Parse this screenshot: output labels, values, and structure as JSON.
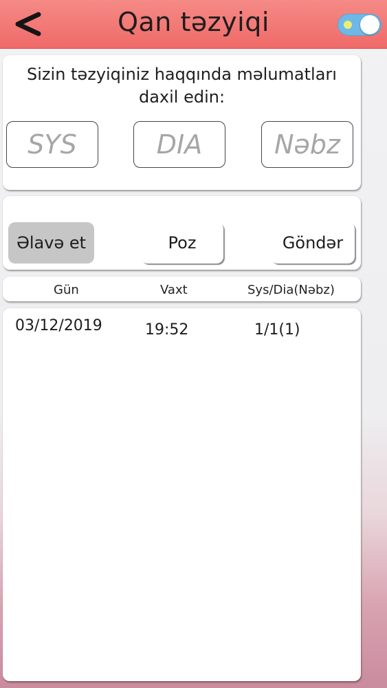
{
  "header": {
    "title": "Qan təzyiqi",
    "back_icon": "chevron-left-icon",
    "toggle_on": true
  },
  "form": {
    "intro": "Sizin təzyiqiniz haqqında məlumatları daxil edin:",
    "sys_placeholder": "SYS",
    "dia_placeholder": "DIA",
    "pulse_placeholder": "Nəbz"
  },
  "actions": {
    "add_label": "Əlavə et",
    "delete_label": "Poz",
    "send_label": "Göndər"
  },
  "table": {
    "columns": [
      "Gün",
      "Vaxt",
      "Sys/Dia(Nəbz)"
    ],
    "rows": [
      {
        "date": "03/12/2019",
        "time": "19:52",
        "reading": "1/1(1)"
      }
    ]
  },
  "colors": {
    "header": "#ef6a68",
    "toggle": "#6fb7e6",
    "active_button": "#c6c6c6"
  }
}
